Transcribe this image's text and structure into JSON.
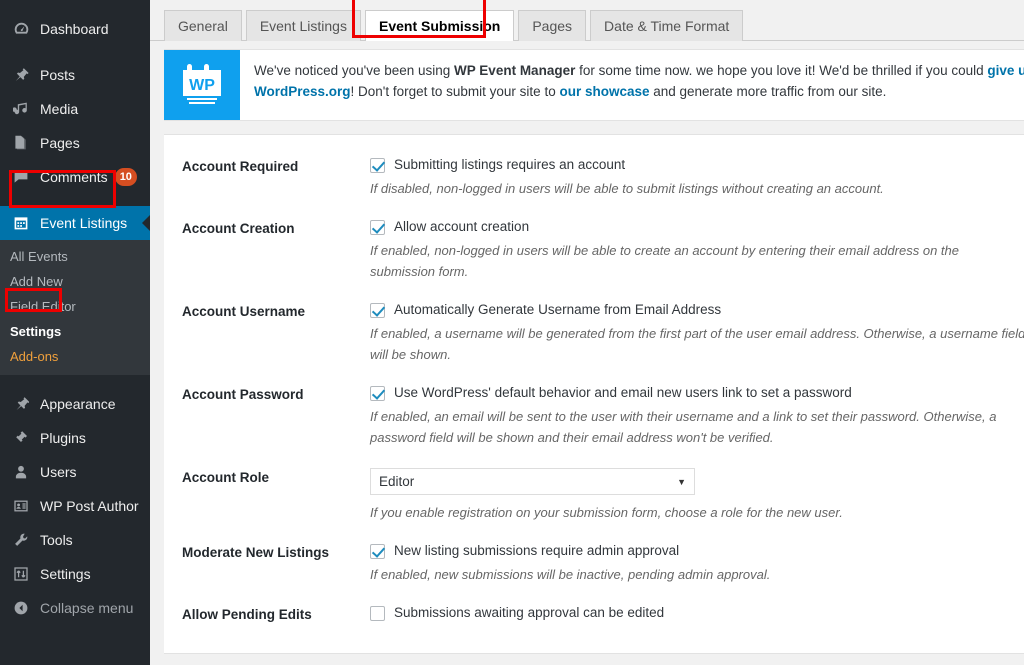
{
  "sidebar": {
    "items": [
      {
        "label": "Dashboard",
        "icon": "dashboard-icon",
        "name": "dashboard"
      },
      {
        "label": "Posts",
        "icon": "pin-icon",
        "name": "posts"
      },
      {
        "label": "Media",
        "icon": "media-icon",
        "name": "media"
      },
      {
        "label": "Pages",
        "icon": "pages-icon",
        "name": "pages"
      },
      {
        "label": "Comments",
        "icon": "comment-icon",
        "name": "comments",
        "badge": "10"
      },
      {
        "label": "Event Listings",
        "icon": "calendar-icon",
        "name": "event-listings",
        "active": true
      }
    ],
    "submenu": [
      {
        "label": "All Events",
        "name": "all-events"
      },
      {
        "label": "Add New",
        "name": "add-new"
      },
      {
        "label": "Field Editor",
        "name": "field-editor"
      },
      {
        "label": "Settings",
        "name": "settings",
        "current": true
      },
      {
        "label": "Add-ons",
        "name": "add-ons",
        "addons": true
      }
    ],
    "items_lower": [
      {
        "label": "Appearance",
        "icon": "appearance-icon",
        "name": "appearance"
      },
      {
        "label": "Plugins",
        "icon": "plugins-icon",
        "name": "plugins"
      },
      {
        "label": "Users",
        "icon": "users-icon",
        "name": "users"
      },
      {
        "label": "WP Post Author",
        "icon": "post-author-icon",
        "name": "wp-post-author"
      },
      {
        "label": "Tools",
        "icon": "tools-icon",
        "name": "tools"
      },
      {
        "label": "Settings",
        "icon": "settings-icon",
        "name": "settings-main"
      },
      {
        "label": "Collapse menu",
        "icon": "collapse-icon",
        "name": "collapse-menu"
      }
    ],
    "active_color": "#0073aa",
    "badge_color": "#d54e21",
    "addons_color": "#f0a03c"
  },
  "tabs": [
    {
      "label": "General",
      "name": "general"
    },
    {
      "label": "Event Listings",
      "name": "event-listings"
    },
    {
      "label": "Event Submission",
      "name": "event-submission",
      "active": true
    },
    {
      "label": "Pages",
      "name": "pages"
    },
    {
      "label": "Date & Time Format",
      "name": "date-time-format"
    }
  ],
  "notice": {
    "logo_text": "WP",
    "part1": "We've noticed you've been using ",
    "plugin_name": "WP Event Manager",
    "part2": " for some time now. we hope you love it! We'd be thrilled if you could ",
    "link1": "give us a nice ratin",
    "part3": "WordPress.org",
    "part4": "! Don't forget to submit your site to ",
    "link2": "our showcase",
    "part5": " and generate more traffic from our site."
  },
  "settings": [
    {
      "label": "Account Required",
      "name": "account-required",
      "checkbox_label": "Submitting listings requires an account",
      "checked": true,
      "hint": "If disabled, non-logged in users will be able to submit listings without creating an account."
    },
    {
      "label": "Account Creation",
      "name": "account-creation",
      "checkbox_label": "Allow account creation",
      "checked": true,
      "hint": "If enabled, non-logged in users will be able to create an account by entering their email address on the submission form."
    },
    {
      "label": "Account Username",
      "name": "account-username",
      "checkbox_label": "Automatically Generate Username from Email Address",
      "checked": true,
      "hint": "If enabled, a username will be generated from the first part of the user email address. Otherwise, a username field will be shown."
    },
    {
      "label": "Account Password",
      "name": "account-password",
      "checkbox_label": "Use WordPress' default behavior and email new users link to set a password",
      "checked": true,
      "hint": "If enabled, an email will be sent to the user with their username and a link to set their password. Otherwise, a password field will be shown and their email address won't be verified."
    },
    {
      "label": "Account Role",
      "name": "account-role",
      "select_value": "Editor",
      "hint": "If you enable registration on your submission form, choose a role for the new user."
    },
    {
      "label": "Moderate New Listings",
      "name": "moderate-new-listings",
      "checkbox_label": "New listing submissions require admin approval",
      "checked": true,
      "hint": "If enabled, new submissions will be inactive, pending admin approval."
    },
    {
      "label": "Allow Pending Edits",
      "name": "allow-pending-edits",
      "checkbox_label": "Submissions awaiting approval can be edited",
      "checked": false,
      "hint": ""
    }
  ],
  "annotation_color": "#ee0000"
}
